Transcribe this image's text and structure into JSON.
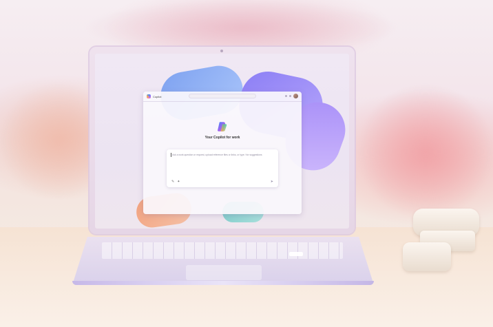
{
  "window": {
    "app_name": "Copilot",
    "address_bar": "",
    "tagline": "Your Copilot for work"
  },
  "prompt": {
    "placeholder": "Ask a work question or request, upload reference files or links, or type / for suggestions",
    "hint": "",
    "icons": {
      "attach": "paperclip-icon",
      "extensions": "sparkle-icon",
      "send": "send-icon"
    }
  },
  "colors": {
    "accent_blue": "#7ea2f0",
    "accent_purple": "#8b7ef5",
    "accent_orange": "#f2a27e",
    "accent_teal": "#7ac9c8"
  }
}
